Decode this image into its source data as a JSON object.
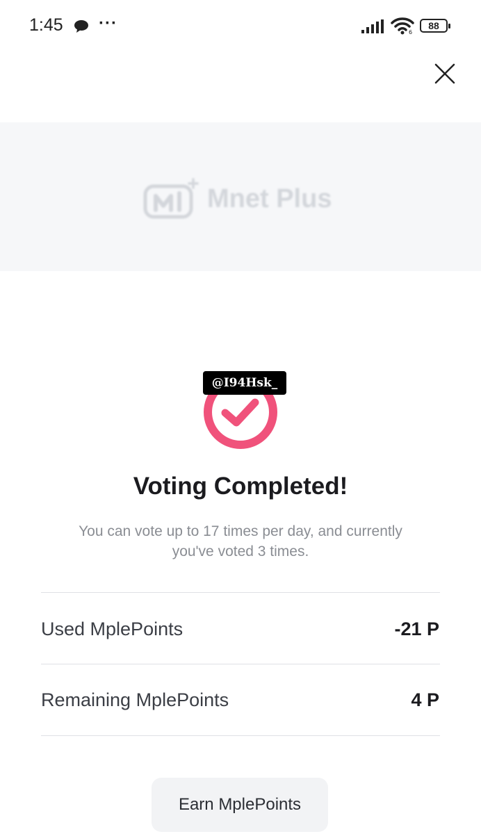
{
  "status_bar": {
    "time": "1:45",
    "more_indicator": "···",
    "battery_level": "88",
    "icons": [
      "chat-bubble-icon",
      "signal-icon",
      "wifi-icon",
      "battery-icon"
    ]
  },
  "header": {
    "close_icon": "close-icon"
  },
  "banner": {
    "logo_text": "Mnet Plus"
  },
  "watermark": "@I94Hsk_",
  "result": {
    "title": "Voting Completed!",
    "subtitle_line1": "You can vote up to 17 times per day, and currently",
    "subtitle_line2": "you've voted 3 times."
  },
  "points": [
    {
      "label": "Used MplePoints",
      "value": "-21 P"
    },
    {
      "label": "Remaining MplePoints",
      "value": "4 P"
    }
  ],
  "actions": {
    "earn_label": "Earn MplePoints"
  },
  "colors": {
    "accent": "#f0527b",
    "divider": "#dfe1e5",
    "banner_bg": "#f6f7f9",
    "button_bg": "#f2f3f5"
  }
}
